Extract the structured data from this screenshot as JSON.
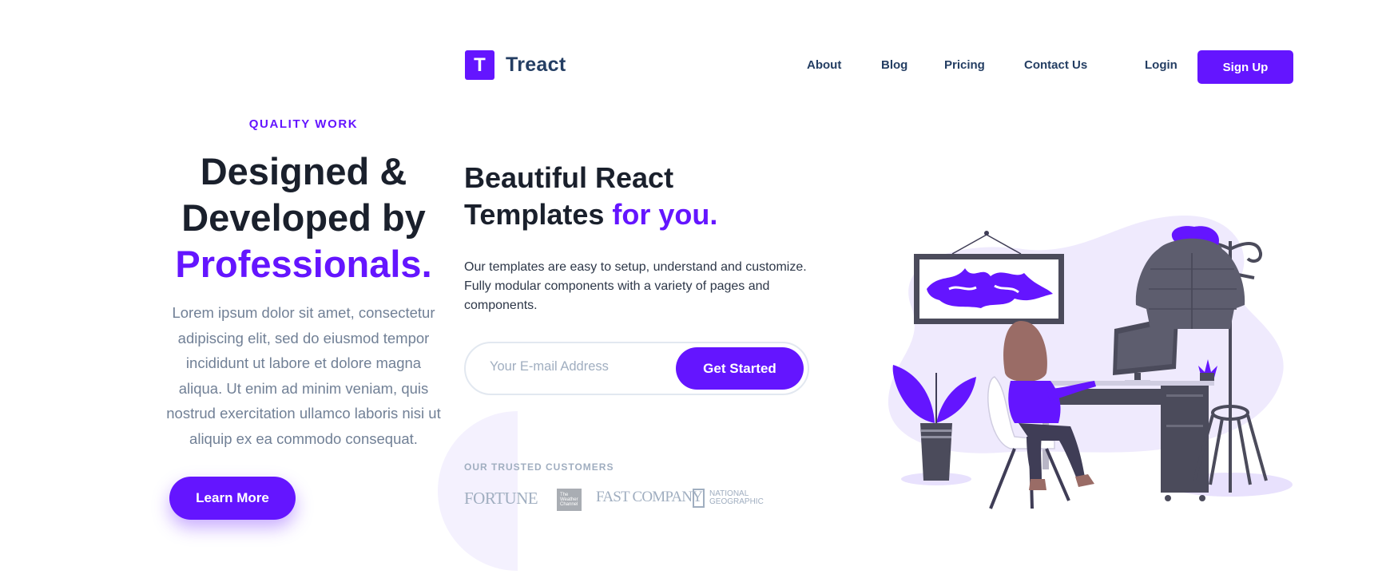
{
  "left_section": {
    "subheading": "Quality Work",
    "title_line1": "Designed &",
    "title_line2": "Developed by",
    "title_accent": "Professionals.",
    "description": "Lorem ipsum dolor sit amet, consectetur adipiscing elit, sed do eiusmod tempor incididunt ut labore et dolore magna aliqua. Ut enim ad minim veniam, quis nostrud exercitation ullamco laboris nisi ut aliquip ex ea commodo consequat.",
    "button_label": "Learn More"
  },
  "header": {
    "logo_letter": "T",
    "logo_text": "Treact",
    "nav": {
      "about": "About",
      "blog": "Blog",
      "pricing": "Pricing",
      "contact": "Contact Us",
      "login": "Login",
      "signup": "Sign Up"
    }
  },
  "hero": {
    "heading_line1": "Beautiful React",
    "heading_line2": "Templates",
    "heading_accent": "for you.",
    "description": "Our templates are easy to setup, understand and customize. Fully modular components with a variety of pages and components.",
    "email_placeholder": "Your E-mail Address",
    "cta_label": "Get Started",
    "trusted_label": "Our Trusted Customers",
    "customers": {
      "fortune": "FORTUNE",
      "weather_1": "The",
      "weather_2": "Weather",
      "weather_3": "Channel",
      "fastcompany": "FAST COMPANY",
      "natgeo_1": "NATIONAL",
      "natgeo_2": "GEOGRAPHIC"
    }
  },
  "colors": {
    "primary": "#6415ff",
    "heading": "#1a202c",
    "nav_text": "#243e63",
    "muted": "#a0aec0",
    "illustration_bg": "#efeafd"
  }
}
